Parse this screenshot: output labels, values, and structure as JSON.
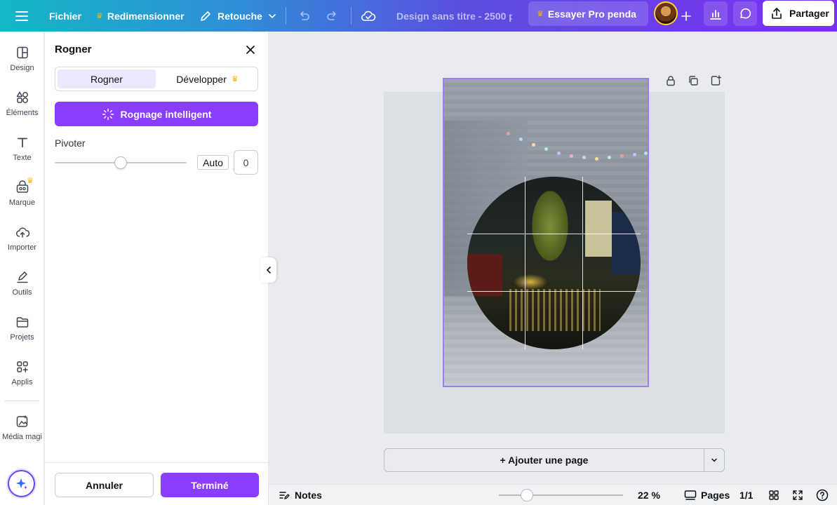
{
  "topbar": {
    "menu_icon": "hamburger-icon",
    "file_label": "Fichier",
    "resize_label": "Redimensionner",
    "edit_label": "Retouche",
    "doc_title": "Design sans titre - 2500 p",
    "try_pro_label": "Essayer Pro penda",
    "share_label": "Partager"
  },
  "rail": {
    "items": [
      {
        "label": "Design",
        "icon": "layout-icon"
      },
      {
        "label": "Éléments",
        "icon": "shapes-icon"
      },
      {
        "label": "Texte",
        "icon": "text-icon"
      },
      {
        "label": "Marque",
        "icon": "brand-icon"
      },
      {
        "label": "Importer",
        "icon": "upload-cloud-icon"
      },
      {
        "label": "Outils",
        "icon": "pen-tool-icon"
      },
      {
        "label": "Projets",
        "icon": "folder-icon"
      },
      {
        "label": "Applis",
        "icon": "apps-grid-icon"
      },
      {
        "label": "Média magi",
        "icon": "magic-media-icon"
      }
    ]
  },
  "panel": {
    "title": "Rogner",
    "tab_crop": "Rogner",
    "tab_expand": "Développer",
    "smart_crop_label": "Rognage intelligent",
    "rotate_label": "Pivoter",
    "rotate_fraction": 0.5,
    "auto_label": "Auto",
    "rotate_value": "0",
    "cancel_label": "Annuler",
    "done_label": "Terminé"
  },
  "canvas": {
    "add_page_label": "+ Ajouter une page"
  },
  "bottombar": {
    "notes_label": "Notes",
    "zoom_value": "22 %",
    "pages_label": "Pages",
    "page_count": "1/1"
  },
  "colors": {
    "accent": "#8b3dff",
    "crown": "#ffb100",
    "crop_frame": "#9b7cff"
  }
}
